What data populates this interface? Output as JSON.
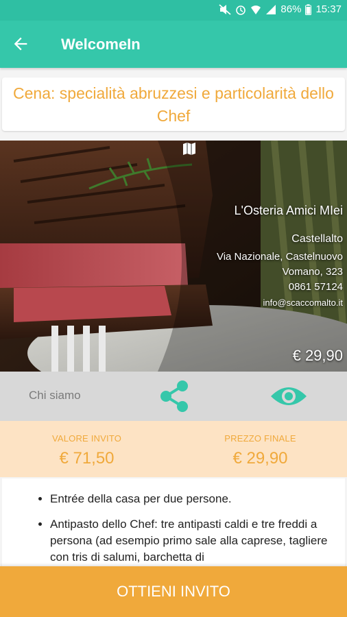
{
  "status_bar": {
    "battery": "86%",
    "time": "15:37"
  },
  "app_bar": {
    "title": "WelcomeIn",
    "back_icon": "arrow-left-icon"
  },
  "offer": {
    "title": "Cena: specialità abruzzesi e particolarità dello Chef"
  },
  "restaurant": {
    "name": "L'Osteria Amici MIei",
    "city": "Castellalto",
    "address_line1": "Via Nazionale, Castelnuovo",
    "address_line2": "Vomano, 323",
    "phone": "0861 57124",
    "email": "info@scaccomalto.it",
    "price": "€ 29,90"
  },
  "actions": {
    "about_label": "Chi siamo",
    "share_icon": "share-icon",
    "view_icon": "eye-icon"
  },
  "prices": {
    "value_label": "VALORE INVITO",
    "value": "€ 71,50",
    "final_label": "PREZZO FINALE",
    "final": "€ 29,90"
  },
  "description": {
    "items": [
      "Entrée della casa per due persone.",
      "Antipasto dello Chef: tre antipasti caldi e tre freddi a persona (ad esempio primo sale alla caprese, tagliere con tris di salumi, barchetta di"
    ]
  },
  "cta": {
    "label": "OTTIENI INVITO"
  },
  "colors": {
    "primary": "#35c7aa",
    "accent": "#f0a93b",
    "price_bg": "#fde3c4"
  }
}
